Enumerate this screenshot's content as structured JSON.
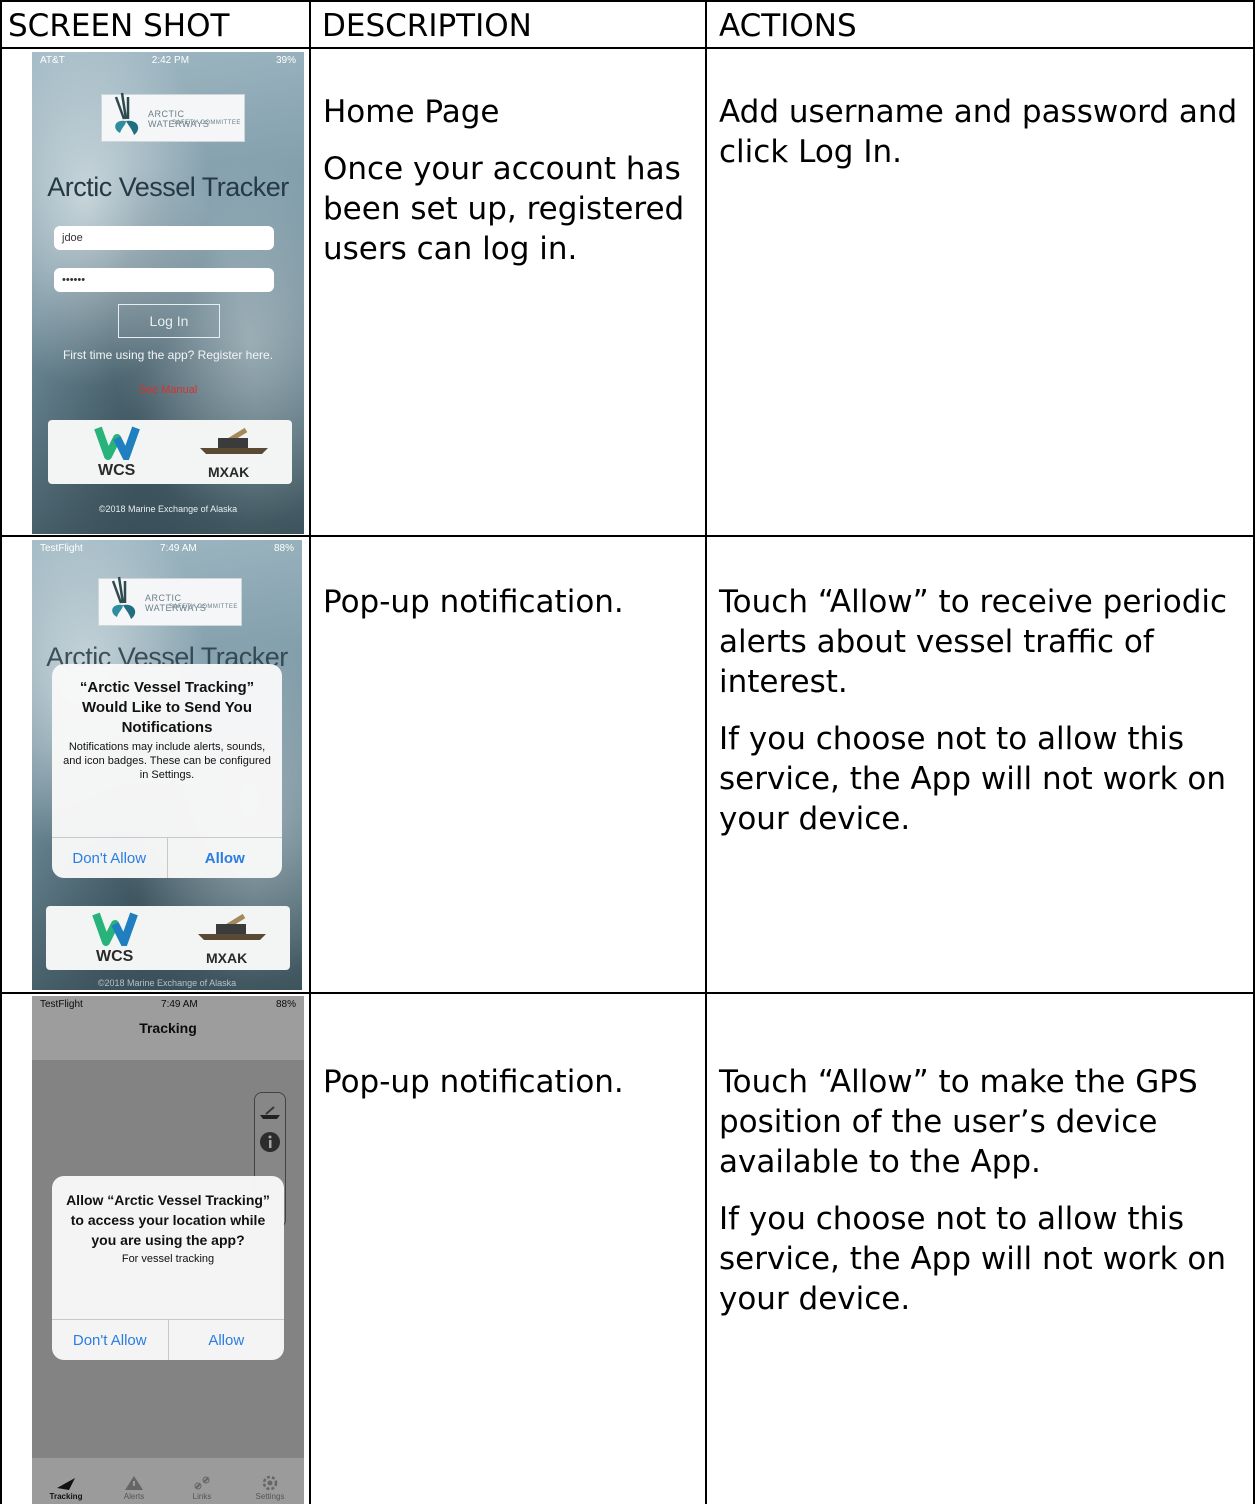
{
  "headers": {
    "screenshot": "SCREEN SHOT",
    "description": "DESCRIPTION",
    "actions": "ACTIONS"
  },
  "rows": [
    {
      "description": [
        "Home Page",
        "Once your account has been set up, registered users can log in."
      ],
      "actions": [
        "Add username and password and click Log In."
      ],
      "phone": {
        "status_left": "AT&T",
        "status_time": "2:42 PM",
        "status_right": "39%",
        "logo_text": "ARCTIC WATERWAYS",
        "logo_subtext": "SAFETY COMMITTEE",
        "app_title": "Arctic Vessel Tracker",
        "username_value": "jdoe",
        "password_value": "••••••",
        "login_label": "Log In",
        "register_text": "First time using the app? Register here.",
        "see_link": "See Manual",
        "wcs_label": "WCS",
        "mxak_label": "MXAK",
        "copyright": "©2018 Marine Exchange of Alaska"
      }
    },
    {
      "description": [
        "Pop-up notification."
      ],
      "actions": [
        "Touch “Allow” to receive periodic alerts about vessel traffic of interest.",
        "If you choose not to allow this service, the App will not work on your device."
      ],
      "phone": {
        "status_left": "TestFlight",
        "status_time": "7:49 AM",
        "status_right": "88%",
        "logo_text": "ARCTIC WATERWAYS",
        "logo_subtext": "SAFETY COMMITTEE",
        "app_title": "Arctic Vessel Tracker",
        "alert_title": "“Arctic Vessel Tracking” Would Like to Send You Notifications",
        "alert_message": "Notifications may include alerts, sounds, and icon badges. These can be configured in Settings.",
        "deny_label": "Don't Allow",
        "allow_label": "Allow",
        "wcs_label": "WCS",
        "mxak_label": "MXAK",
        "copyright": "©2018 Marine Exchange of Alaska"
      }
    },
    {
      "description": [
        "Pop-up notification."
      ],
      "actions": [
        "Touch “Allow” to make the GPS position of the user’s device available to the App.",
        "If you choose not to allow this service, the App will not work on your device."
      ],
      "phone": {
        "status_left": "TestFlight",
        "status_time": "7:49 AM",
        "status_right": "88%",
        "nav_title": "Tracking",
        "alert_title": "Allow “Arctic Vessel Tracking” to access your location while you are using the app?",
        "alert_message": "For vessel tracking",
        "deny_label": "Don't Allow",
        "allow_label": "Allow",
        "tabs": [
          "Tracking",
          "Alerts",
          "Links",
          "Settings"
        ]
      }
    }
  ]
}
